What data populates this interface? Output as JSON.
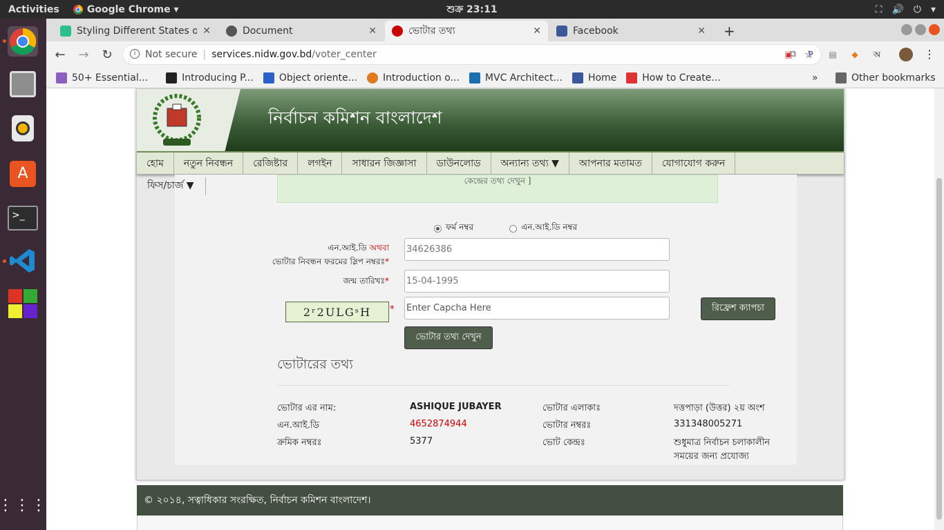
{
  "topbar": {
    "activities": "Activities",
    "app": "Google Chrome ▾",
    "clock": "শুক্র 23:11"
  },
  "tabs": [
    {
      "label": "Styling Different States o",
      "color": "#2bbf8a"
    },
    {
      "label": "Document",
      "color": "#555"
    },
    {
      "label": "ভোটার তথ্য",
      "color": "#c00"
    },
    {
      "label": "Facebook",
      "color": "#3b5998"
    }
  ],
  "toolbar": {
    "not_secure": "Not secure",
    "url_host": "services.nidw.gov.bd",
    "url_path": "/voter_center"
  },
  "bookmarks": [
    {
      "label": "50+ Essential...",
      "color": "#8a5fbf"
    },
    {
      "label": "Introducing P...",
      "color": "#222"
    },
    {
      "label": "Object oriente...",
      "color": "#2a62c9"
    },
    {
      "label": "Introduction o...",
      "color": "#e07a1f"
    },
    {
      "label": "MVC Architect...",
      "color": "#1a6fb0"
    },
    {
      "label": "Home",
      "color": "#3b5998"
    },
    {
      "label": "How to Create...",
      "color": "#d33"
    }
  ],
  "bookmarks_overflow": "»",
  "other_bookmarks": "Other bookmarks",
  "site": {
    "title": "নির্বাচন কমিশন বাংলাদেশ",
    "menu": [
      "হোম",
      "নতুন নিবন্ধন",
      "রেজিষ্টার",
      "লগইন",
      "সাধারন জিজ্ঞাসা",
      "ডাউনলোড",
      "অন্যান্য তথ্য ▼",
      "আপনার মতামত",
      "যোগাযোগ করুন"
    ],
    "fees": "ফিস/চার্জ ▼",
    "notice": "কেন্দ্রের তথ্য দেখুন ]",
    "radio_form": "ফর্ম নম্বর",
    "radio_nid": "এন.আই.ডি নম্বর",
    "label_nid_a": "এন.আই.ডি",
    "label_nid_or": "অথবা",
    "label_nid_b": "ভোটার নিবন্ধন ফরমের স্লিপ নম্বরঃ",
    "label_dob": "জন্ম তারিখঃ",
    "input_number": "34626386",
    "input_dob": "15-04-1995",
    "captcha_placeholder": "Enter Capcha Here",
    "captcha_text": "2ʳ2ULGˢH",
    "refresh_btn": "রিফ্রেশ ক্যাপচা",
    "submit_btn": "ভোটার তথ্য দেখুন",
    "section_title": "ভোটারের তথ্য",
    "info": {
      "name_label": "ভোটার এর নাম:",
      "name_value": "ASHIQUE JUBAYER",
      "area_label": "ভোটার এলাকাঃ",
      "area_value": "দত্তপাড়া (উত্তর) ২য় অংশ",
      "nid_label": "এন.আই.ডি",
      "nid_value": "4652874944",
      "voter_no_label": "ভোটার নম্বরঃ",
      "voter_no_value": "331348005271",
      "serial_label": "ক্রমিক নম্বরঃ",
      "serial_value": "5377",
      "center_label": "ভোট কেন্দ্রঃ",
      "center_value_1": "শুধুমাত্র নির্বাচন চলাকালীন",
      "center_value_2": "সময়ের জন্য প্রযোজ্য"
    },
    "footer": "© ২০১৪, সত্বাধিকার সংরক্ষিত, নির্বাচন কমিশন বাংলাদেশ।"
  }
}
